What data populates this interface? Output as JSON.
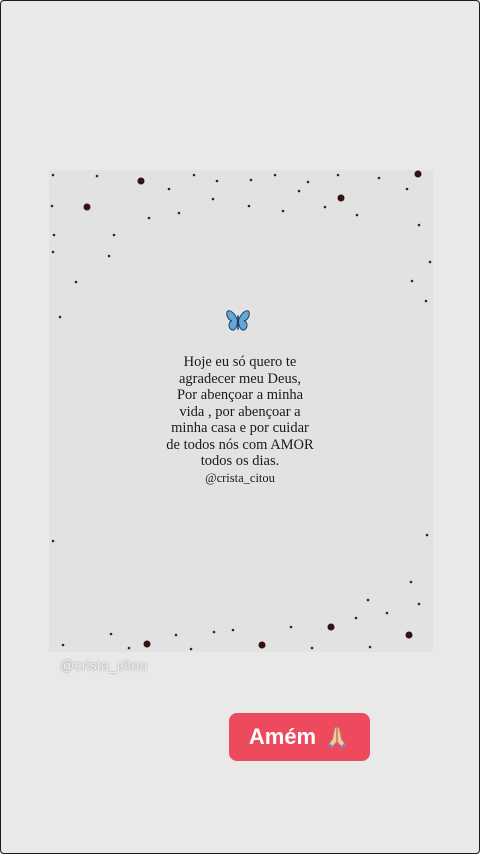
{
  "story": {
    "message": "Hoje eu só quero te\nagradecer meu Deus,\nPor abençoar a minha\nvida , por abençoar a\nminha casa e por cuidar\nde todos nós com AMOR\ntodos os dias.",
    "handle": "@crista_citou",
    "watermark": "@crista_citou",
    "sticker_label": "Amém",
    "icons": {
      "decoration": "butterfly-icon",
      "sticker": "praying-hands-icon"
    },
    "colors": {
      "background": "#e9e9e9",
      "card": "#e2e2e2",
      "dots": "#5a1616",
      "sticker": "#ee4a5e"
    }
  }
}
